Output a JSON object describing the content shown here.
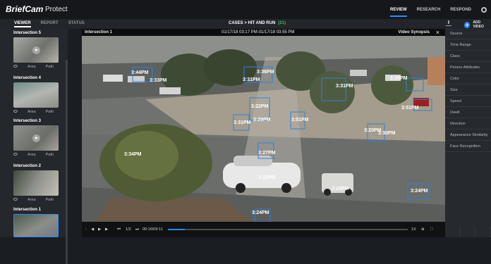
{
  "app": {
    "brand": "BriefCam",
    "product": "Protect"
  },
  "topnav": {
    "items": [
      "REVIEW",
      "RESEARCH",
      "RESPOND"
    ],
    "active": "REVIEW"
  },
  "subnav": {
    "tabs": [
      "VIEWER",
      "REPORT",
      "STATUS"
    ],
    "active": "VIEWER"
  },
  "breadcrumb": {
    "text": "CASES > HIT AND RUN",
    "count": "(21)"
  },
  "actions": {
    "add_video": "ADD VIDEO"
  },
  "sidebar": {
    "items": [
      {
        "title": "Intersection 5",
        "meta_left": "Area",
        "meta_right": "Path"
      },
      {
        "title": "Intersection 4",
        "meta_left": "Area",
        "meta_right": "Path"
      },
      {
        "title": "Intersection 3",
        "meta_left": "Area",
        "meta_right": "Path"
      },
      {
        "title": "Intersection 2",
        "meta_left": "Area",
        "meta_right": "Path"
      },
      {
        "title": "Intersection 1",
        "meta_left": "",
        "meta_right": ""
      }
    ]
  },
  "video": {
    "title": "Intersection 1",
    "time_range": "01/17/18 03:17 PM-01/17/18 03:55 PM",
    "mode": "Video Synopsis",
    "timestamps": [
      "3:44PM",
      "3:33PM",
      "3:36PM",
      "3:31PM",
      "3:31PM",
      "3:22PM",
      "3:51PM",
      "3:28PM",
      "3:31PM",
      "3:29PM",
      "3:51PM",
      "3:20PM",
      "3:34PM",
      "3:27PM",
      "3:22PM",
      "3:23PM",
      "3:24PM",
      "3:24PM",
      "3:30PM"
    ],
    "controls": {
      "page": "1/2",
      "time": "00:16/09:11",
      "speed": "1X"
    },
    "progress": 0.07
  },
  "filters": [
    "Source",
    "Time Range",
    "Class",
    "Person Attributes",
    "Color",
    "Size",
    "Speed",
    "Dwell",
    "Direction",
    "Appearance Similarity",
    "Face Recognition"
  ],
  "colors": {
    "accent": "#2b8cff",
    "count_green": "#39c15a"
  }
}
